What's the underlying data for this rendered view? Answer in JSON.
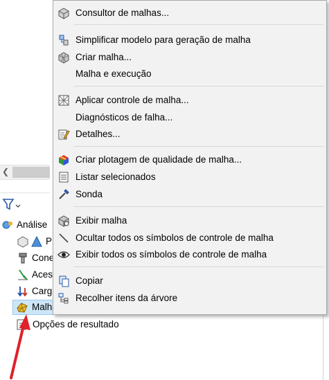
{
  "panel": {
    "tree": [
      {
        "label": "Análise",
        "icon": "study-icon"
      },
      {
        "label": "P",
        "icon": "part-icon"
      },
      {
        "label": "Cone",
        "icon": "connections-icon"
      },
      {
        "label": "Aces",
        "icon": "fixtures-icon"
      },
      {
        "label": "Carg",
        "icon": "loads-icon"
      },
      {
        "label": "Malha",
        "icon": "mesh-icon"
      },
      {
        "label": "Opções de resultado",
        "icon": "result-options-icon"
      }
    ],
    "filter_icon": "filter-icon",
    "scroll_left_icon": "chevron-left-icon"
  },
  "menu": {
    "items": [
      {
        "label": "Consultor de malhas...",
        "icon": "mesh-advisor-icon"
      },
      {
        "label": "Simplificar modelo para geração de malha",
        "icon": "simplify-icon"
      },
      {
        "label": "Criar malha...",
        "icon": "create-mesh-icon"
      },
      {
        "label": "Malha e execução",
        "icon": ""
      },
      {
        "label": "Aplicar controle de malha...",
        "icon": "mesh-control-icon"
      },
      {
        "label": "Diagnósticos de falha...",
        "icon": ""
      },
      {
        "label": "Detalhes...",
        "icon": "details-icon"
      },
      {
        "label": "Criar plotagem de qualidade de malha...",
        "icon": "quality-plot-icon"
      },
      {
        "label": "Listar selecionados",
        "icon": "list-icon"
      },
      {
        "label": "Sonda",
        "icon": "probe-icon"
      },
      {
        "label": "Exibir malha",
        "icon": "show-mesh-icon"
      },
      {
        "label": "Ocultar todos os símbolos de controle de malha",
        "icon": "hide-symbols-icon"
      },
      {
        "label": "Exibir todos os símbolos de controle de malha",
        "icon": "eye-icon"
      },
      {
        "label": "Copiar",
        "icon": "copy-icon"
      },
      {
        "label": "Recolher itens da árvore",
        "icon": "collapse-tree-icon"
      }
    ]
  },
  "colors": {
    "menu_bg": "#f2f2f2",
    "highlight": "#cde6f7",
    "arrow": "#e0202a"
  }
}
